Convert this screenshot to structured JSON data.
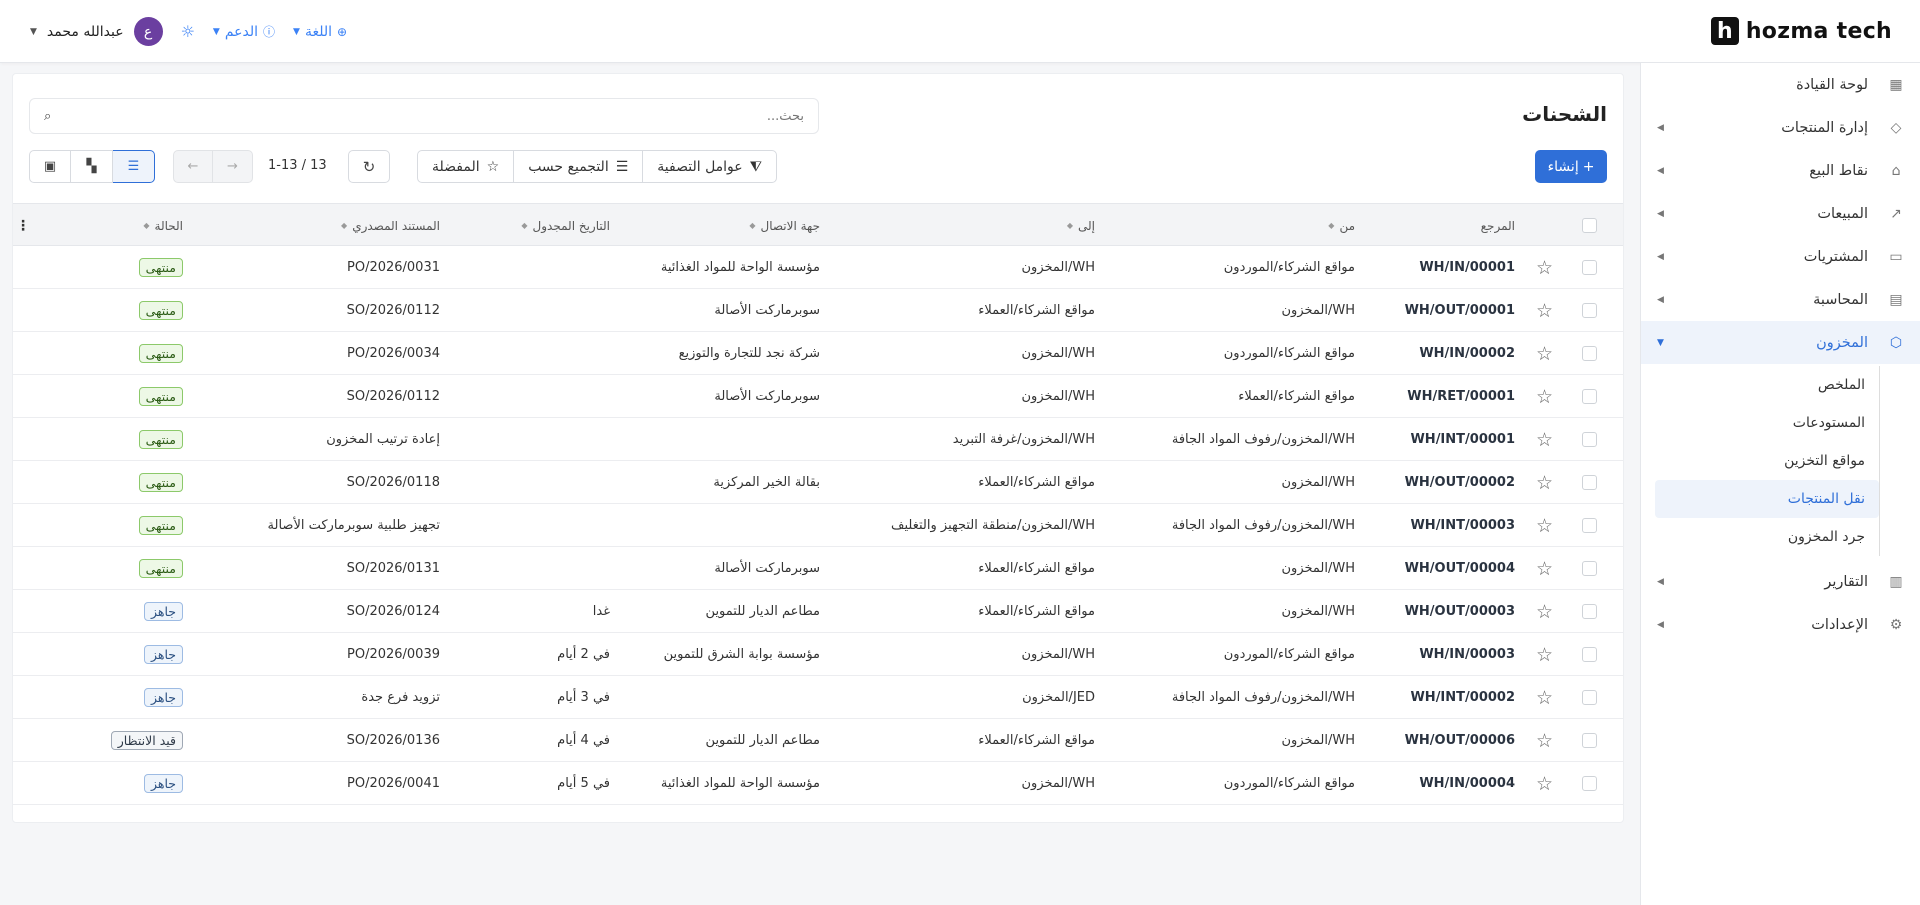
{
  "brand": {
    "mark": "h",
    "name": "hozma tech"
  },
  "topbar": {
    "user_name": "عبدالله محمد",
    "avatar_initial": "ع",
    "support_label": "الدعم",
    "language_label": "اللغة"
  },
  "sidebar": {
    "items": [
      {
        "label": "لوحة القيادة",
        "icon": "dashboard-icon"
      },
      {
        "label": "إدارة المنتجات",
        "icon": "tag-icon"
      },
      {
        "label": "نقاط البيع",
        "icon": "store-icon"
      },
      {
        "label": "المبيعات",
        "icon": "chart-icon"
      },
      {
        "label": "المشتريات",
        "icon": "wallet-icon"
      },
      {
        "label": "المحاسبة",
        "icon": "calculator-icon"
      },
      {
        "label": "المخزون",
        "icon": "box-icon"
      },
      {
        "label": "التقارير",
        "icon": "report-icon"
      },
      {
        "label": "الإعدادات",
        "icon": "gear-icon"
      }
    ],
    "inventory_sub": [
      "الملخص",
      "المستودعات",
      "مواقع التخزين",
      "نقل المنتجات",
      "جرد المخزون"
    ]
  },
  "page": {
    "title": "الشحنات",
    "search_placeholder": "بحث...",
    "create_label": "إنشاء",
    "filters_label": "عوامل التصفية",
    "group_by_label": "التجميع حسب",
    "favorites_label": "المفضلة",
    "pager_text": "1-13 / 13"
  },
  "table": {
    "headers": {
      "ref": "المرجع",
      "from": "من",
      "to": "إلى",
      "contact": "جهة الاتصال",
      "scheduled": "التاريخ المجدول",
      "source": "المستند المصدري",
      "status": "الحالة"
    },
    "rows": [
      {
        "ref": "WH/IN/00001",
        "from": "مواقع الشركاء/الموردون",
        "to": "WH/المخزون",
        "contact": "مؤسسة الواحة للمواد الغذائية",
        "date": "",
        "source": "PO/2026/0031",
        "status": "منتهى"
      },
      {
        "ref": "WH/OUT/00001",
        "from": "WH/المخزون",
        "to": "مواقع الشركاء/العملاء",
        "contact": "سوبرماركت الأصالة",
        "date": "",
        "source": "SO/2026/0112",
        "status": "منتهى"
      },
      {
        "ref": "WH/IN/00002",
        "from": "مواقع الشركاء/الموردون",
        "to": "WH/المخزون",
        "contact": "شركة نجد للتجارة والتوزيع",
        "date": "",
        "source": "PO/2026/0034",
        "status": "منتهى"
      },
      {
        "ref": "WH/RET/00001",
        "from": "مواقع الشركاء/العملاء",
        "to": "WH/المخزون",
        "contact": "سوبرماركت الأصالة",
        "date": "",
        "source": "SO/2026/0112",
        "status": "منتهى"
      },
      {
        "ref": "WH/INT/00001",
        "from": "WH/المخزون/رفوف المواد الجافة",
        "to": "WH/المخزون/غرفة التبريد",
        "contact": "",
        "date": "",
        "source": "إعادة ترتيب المخزون",
        "status": "منتهى"
      },
      {
        "ref": "WH/OUT/00002",
        "from": "WH/المخزون",
        "to": "مواقع الشركاء/العملاء",
        "contact": "بقالة الخير المركزية",
        "date": "",
        "source": "SO/2026/0118",
        "status": "منتهى"
      },
      {
        "ref": "WH/INT/00003",
        "from": "WH/المخزون/رفوف المواد الجافة",
        "to": "WH/المخزون/منطقة التجهيز والتغليف",
        "contact": "",
        "date": "",
        "source": "تجهيز طلبية سوبرماركت الأصالة",
        "status": "منتهى"
      },
      {
        "ref": "WH/OUT/00004",
        "from": "WH/المخزون",
        "to": "مواقع الشركاء/العملاء",
        "contact": "سوبرماركت الأصالة",
        "date": "",
        "source": "SO/2026/0131",
        "status": "منتهى"
      },
      {
        "ref": "WH/OUT/00003",
        "from": "WH/المخزون",
        "to": "مواقع الشركاء/العملاء",
        "contact": "مطاعم الديار للتموين",
        "date": "غدا",
        "source": "SO/2026/0124",
        "status": "جاهز"
      },
      {
        "ref": "WH/IN/00003",
        "from": "مواقع الشركاء/الموردون",
        "to": "WH/المخزون",
        "contact": "مؤسسة بوابة الشرق للتموين",
        "date": "في 2 أيام",
        "source": "PO/2026/0039",
        "status": "جاهز"
      },
      {
        "ref": "WH/INT/00002",
        "from": "WH/المخزون/رفوف المواد الجافة",
        "to": "JED/المخزون",
        "contact": "",
        "date": "في 3 أيام",
        "source": "تزويد فرع جدة",
        "status": "جاهز"
      },
      {
        "ref": "WH/OUT/00006",
        "from": "WH/المخزون",
        "to": "مواقع الشركاء/العملاء",
        "contact": "مطاعم الديار للتموين",
        "date": "في 4 أيام",
        "source": "SO/2026/0136",
        "status": "قيد الانتظار"
      },
      {
        "ref": "WH/IN/00004",
        "from": "مواقع الشركاء/الموردون",
        "to": "WH/المخزون",
        "contact": "مؤسسة الواحة للمواد الغذائية",
        "date": "في 5 أيام",
        "source": "PO/2026/0041",
        "status": "جاهز"
      }
    ]
  },
  "colors": {
    "accent": "#2f6fd8",
    "done": "#8cc96a",
    "ready": "#9dbbe3",
    "avatar": "#6b3fa0"
  }
}
